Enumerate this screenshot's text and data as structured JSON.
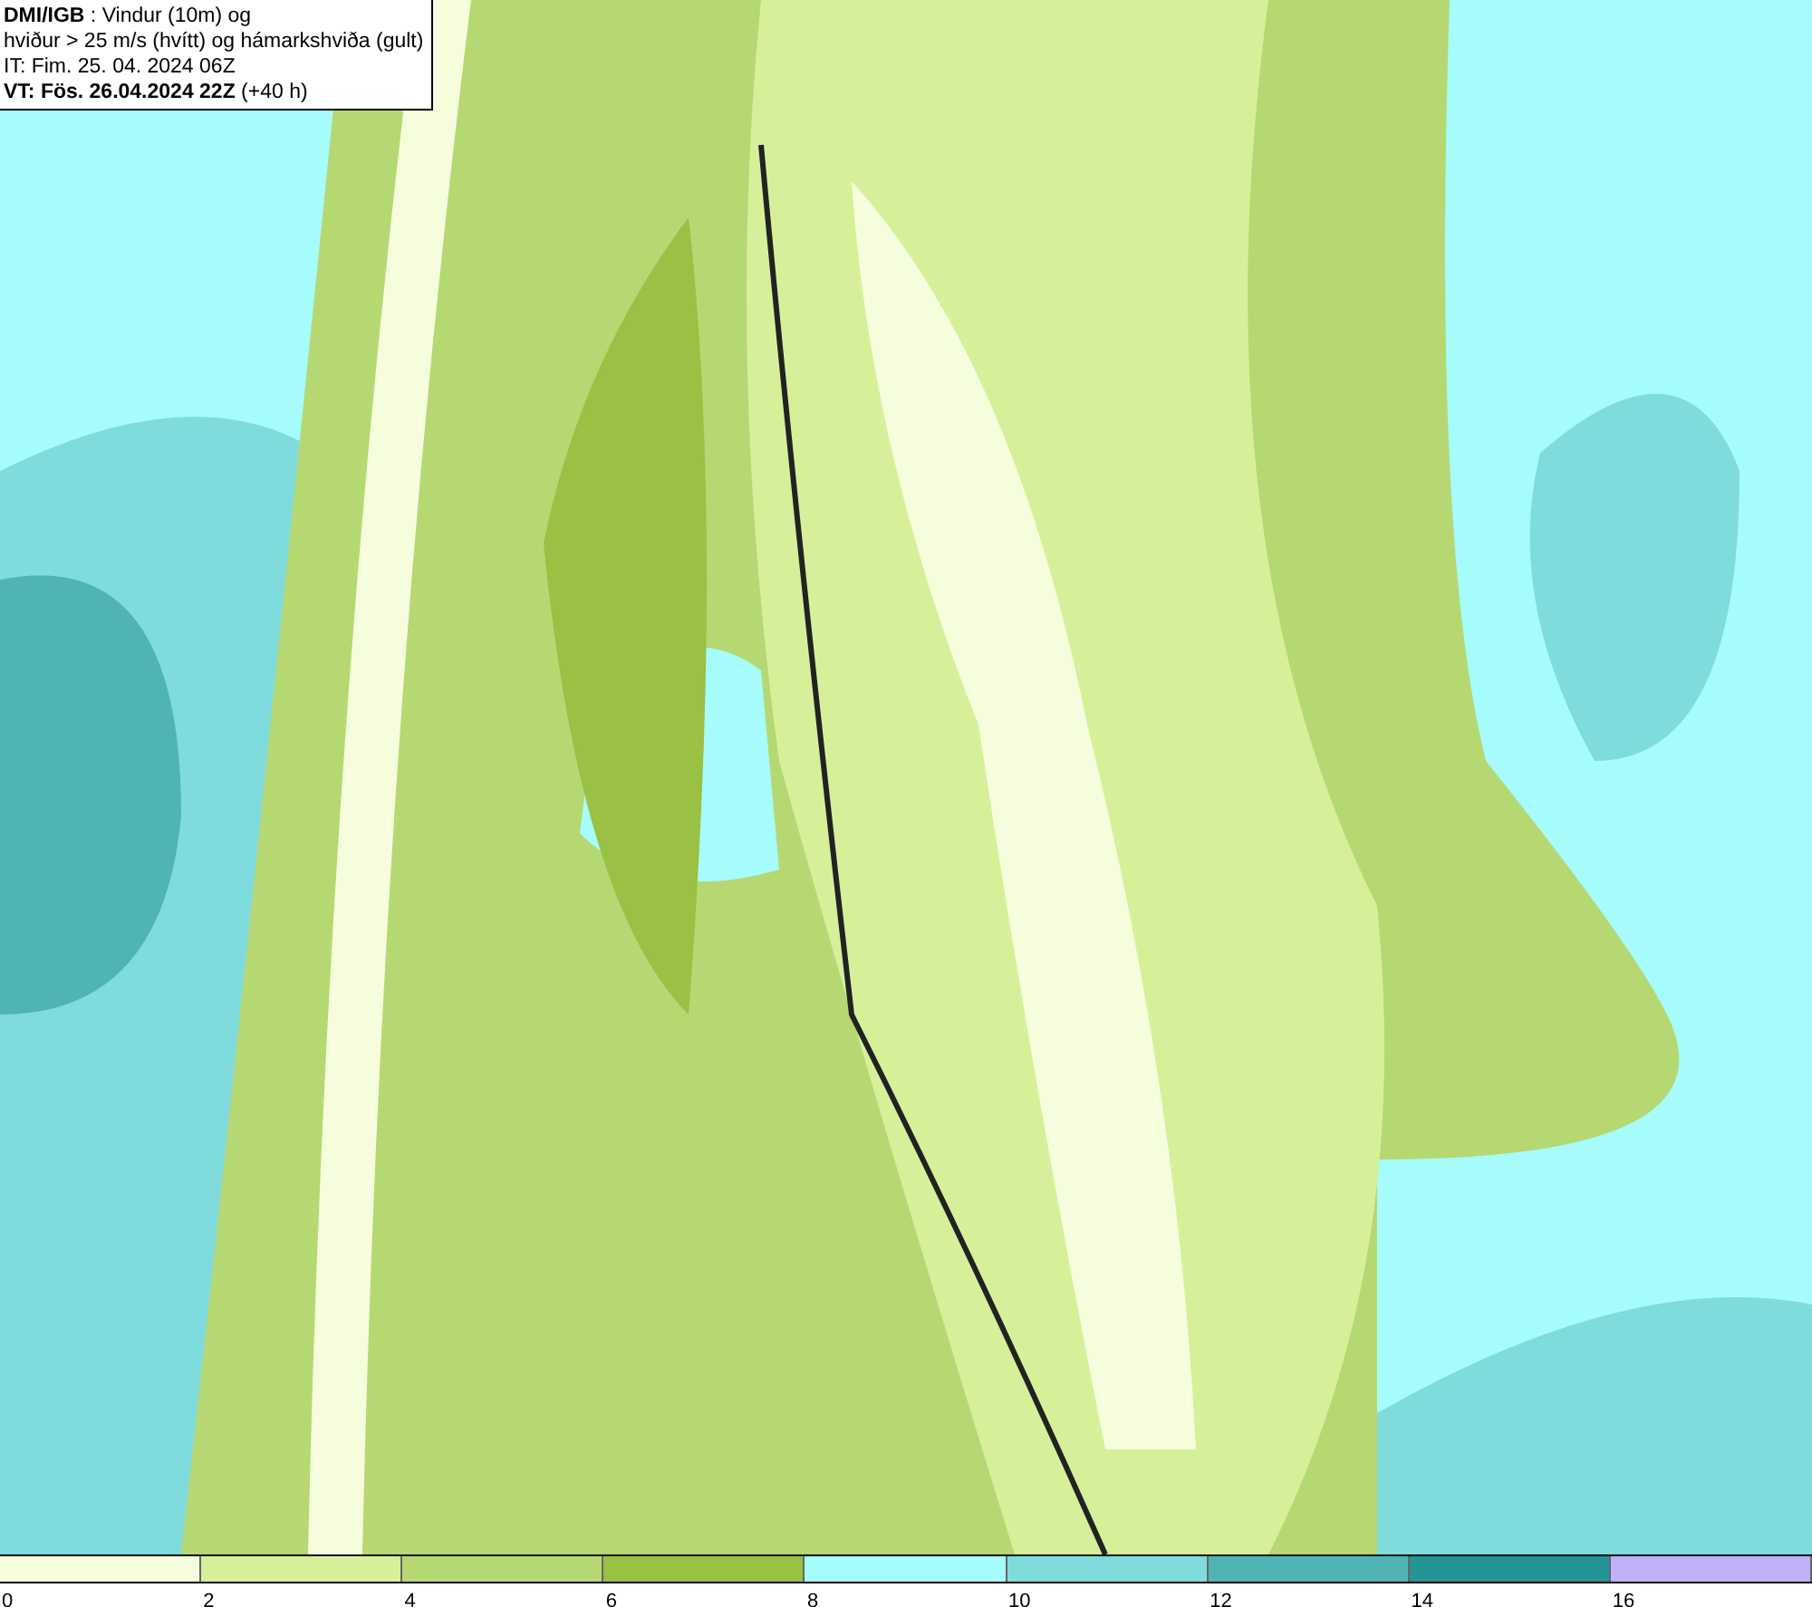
{
  "title": {
    "lines": [
      "**DMI/IGB** : Vindur (10m) og",
      "hviður > 25 m/s (hvítt) og hámarkshviða (gult)",
      "IT: Fim. 25. 04. 2024 06Z",
      "**VT: Fös. 26.04.2024 22Z** (+40 h)"
    ]
  },
  "legend": {
    "bins": [
      {
        "color": "#f5fddc",
        "tick": "0"
      },
      {
        "color": "#d6f09a",
        "tick": "2"
      },
      {
        "color": "#b6d872",
        "tick": "4"
      },
      {
        "color": "#9ac044",
        "tick": "6"
      },
      {
        "color": "#a6fbfb",
        "tick": "8"
      },
      {
        "color": "#80dcdc",
        "tick": "10"
      },
      {
        "color": "#50b4b4",
        "tick": "12"
      },
      {
        "color": "#249494",
        "tick": "14"
      },
      {
        "color": "#c0b0f8",
        "tick": "16"
      }
    ]
  }
}
